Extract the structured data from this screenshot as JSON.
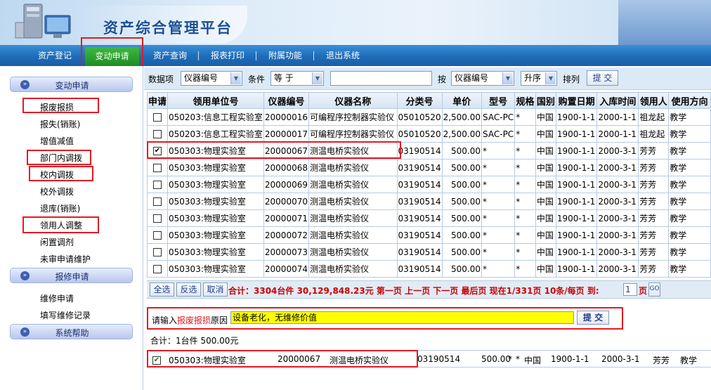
{
  "header": {
    "title": "资产综合管理平台"
  },
  "nav": {
    "items": [
      "资产登记",
      "变动申请",
      "资产查询",
      "报表打印",
      "附属功能",
      "退出系统"
    ],
    "active": "变动申请"
  },
  "sidebar": {
    "section1": "变动申请",
    "section1_links": [
      "报废报损",
      "报失(销账)",
      "增值减值",
      "部门内调拨",
      "校内调拨",
      "校外调拨",
      "退库(销账)",
      "领用人调整",
      "闲置调剂",
      "未审申请维护"
    ],
    "section2": "报修申请",
    "section2_links": [
      "维修申请",
      "填写维修记录"
    ],
    "section3": "系统帮助"
  },
  "toolbar": {
    "field_label": "数据项",
    "field_value": "仪器编号",
    "cond_label": "条件",
    "cond_value": "等 于",
    "search_value": "",
    "by_label": "按",
    "sort_field": "仪器编号",
    "sort_order": "升序",
    "sort_label": "排列",
    "submit": "提 交"
  },
  "grid": {
    "headers": [
      "申请",
      "领用单位号",
      "仪器编号",
      "仪器名称",
      "分类号",
      "单价",
      "型号",
      "规格",
      "国别",
      "购置日期",
      "入库时间",
      "领用人",
      "使用方向"
    ],
    "rows": [
      {
        "checked": false,
        "unit": "050203:信息工程实验室",
        "code": "20000016",
        "name": "可编程序控制器实验仪",
        "cls": "05010520",
        "price": "2,500.00",
        "model": "SAC-PC",
        "spec": "*",
        "country": "中国",
        "buy": "1900-1-1",
        "in": "2000-1-1",
        "user": "祖龙起",
        "use": "教学"
      },
      {
        "checked": false,
        "unit": "050203:信息工程实验室",
        "code": "20000017",
        "name": "可编程序控制器实验仪",
        "cls": "05010520",
        "price": "2,500.00",
        "model": "SAC-PC",
        "spec": "*",
        "country": "中国",
        "buy": "1900-1-1",
        "in": "2000-1-1",
        "user": "祖龙起",
        "use": "教学"
      },
      {
        "checked": true,
        "unit": "050303:物理实验室",
        "code": "20000067",
        "name": "测温电桥实验仪",
        "cls": "03190514",
        "price": "500.00",
        "model": "*",
        "spec": "*",
        "country": "中国",
        "buy": "1900-1-1",
        "in": "2000-3-1",
        "user": "芳芳",
        "use": "教学"
      },
      {
        "checked": false,
        "unit": "050303:物理实验室",
        "code": "20000068",
        "name": "测温电桥实验仪",
        "cls": "03190514",
        "price": "500.00",
        "model": "*",
        "spec": "*",
        "country": "中国",
        "buy": "1900-1-1",
        "in": "2000-3-1",
        "user": "芳芳",
        "use": "教学"
      },
      {
        "checked": false,
        "unit": "050303:物理实验室",
        "code": "20000069",
        "name": "测温电桥实验仪",
        "cls": "03190514",
        "price": "500.00",
        "model": "*",
        "spec": "*",
        "country": "中国",
        "buy": "1900-1-1",
        "in": "2000-3-1",
        "user": "芳芳",
        "use": "教学"
      },
      {
        "checked": false,
        "unit": "050303:物理实验室",
        "code": "20000070",
        "name": "测温电桥实验仪",
        "cls": "03190514",
        "price": "500.00",
        "model": "*",
        "spec": "*",
        "country": "中国",
        "buy": "1900-1-1",
        "in": "2000-3-1",
        "user": "芳芳",
        "use": "教学"
      },
      {
        "checked": false,
        "unit": "050303:物理实验室",
        "code": "20000071",
        "name": "测温电桥实验仪",
        "cls": "03190514",
        "price": "500.00",
        "model": "*",
        "spec": "*",
        "country": "中国",
        "buy": "1900-1-1",
        "in": "2000-3-1",
        "user": "芳芳",
        "use": "教学"
      },
      {
        "checked": false,
        "unit": "050303:物理实验室",
        "code": "20000072",
        "name": "测温电桥实验仪",
        "cls": "03190514",
        "price": "500.00",
        "model": "*",
        "spec": "*",
        "country": "中国",
        "buy": "1900-1-1",
        "in": "2000-3-1",
        "user": "芳芳",
        "use": "教学"
      },
      {
        "checked": false,
        "unit": "050303:物理实验室",
        "code": "20000073",
        "name": "测温电桥实验仪",
        "cls": "03190514",
        "price": "500.00",
        "model": "*",
        "spec": "*",
        "country": "中国",
        "buy": "1900-1-1",
        "in": "2000-3-1",
        "user": "芳芳",
        "use": "教学"
      },
      {
        "checked": false,
        "unit": "050303:物理实验室",
        "code": "20000074",
        "name": "测温电桥实验仪",
        "cls": "03190514",
        "price": "500.00",
        "model": "*",
        "spec": "*",
        "country": "中国",
        "buy": "1900-1-1",
        "in": "2000-3-1",
        "user": "芳芳",
        "use": "教学"
      }
    ]
  },
  "pager": {
    "select_all": "全选",
    "invert": "反选",
    "cancel": "取消",
    "summary": "合计：3304台件 30,129,848.23元 第一页 上一页 下一页 最后页 现在1/331页 10条/每页 到:",
    "page_input": "1",
    "page_unit": "页",
    "go": "GO"
  },
  "reason": {
    "prefix": "请输入",
    "type": "报废报损",
    "suffix": "原因",
    "value": "设备老化，无维修价值",
    "submit": "提 交"
  },
  "selected": {
    "total": "合计：1台件 500.00元",
    "checked": true,
    "unit": "050303:物理实验室",
    "code": "20000067",
    "name": "测温电桥实验仪",
    "cls": "03190514",
    "price": "500.00",
    "model": "*",
    "spec": "*",
    "country": "中国",
    "buy": "1900-1-1",
    "in": "2000-3-1",
    "user": "芳芳",
    "use": "教学"
  },
  "colors": {
    "nav": "#1e6cb8",
    "active": "#1e8c22",
    "highlight": "#e21b23",
    "reason_bg": "#ffff00",
    "summary": "#cc0000"
  }
}
